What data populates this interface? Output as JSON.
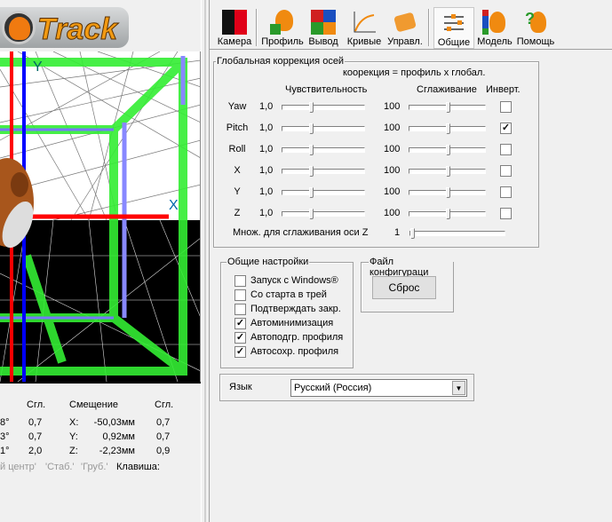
{
  "logo": {
    "text": "Track"
  },
  "toolbar": {
    "items": [
      {
        "label": "Камера",
        "icon": "camera-icon"
      },
      {
        "label": "Профиль",
        "icon": "profile-icon"
      },
      {
        "label": "Вывод",
        "icon": "output-icon"
      },
      {
        "label": "Кривые",
        "icon": "curves-icon"
      },
      {
        "label": "Управл.",
        "icon": "control-icon"
      },
      {
        "label": "Общие",
        "icon": "general-settings-icon",
        "active": true
      },
      {
        "label": "Модель",
        "icon": "model-icon"
      },
      {
        "label": "Помощь",
        "icon": "help-icon"
      }
    ]
  },
  "viewport": {
    "axis_y": "Y",
    "axis_x": "X"
  },
  "bottom": {
    "headers": {
      "smooth1": "Сгл.",
      "offset": "Смещение",
      "smooth2": "Сгл."
    },
    "rows": [
      {
        "rot": "8°",
        "s1": "0,7",
        "axis": "X:",
        "off": "-50,03мм",
        "s2": "0,7"
      },
      {
        "rot": "3°",
        "s1": "0,7",
        "axis": "Y:",
        "off": "0,92мм",
        "s2": "0,7"
      },
      {
        "rot": "1°",
        "s1": "2,0",
        "axis": "Z:",
        "off": "-2,23мм",
        "s2": "0,9"
      }
    ],
    "buttons": [
      "й центр'",
      "'Стаб.'",
      "'Груб.'"
    ],
    "key_label": "Клавиша:"
  },
  "global": {
    "title": "Глобальная коррекция осей",
    "formula": "коорекция = профиль x глобал.",
    "col_sens": "Чувствительность",
    "col_smooth": "Сглаживание",
    "col_invert": "Инверт.",
    "rows": [
      {
        "axis": "Yaw",
        "sens": "1,0",
        "sens_pos": 0.34,
        "smooth": "100",
        "smooth_pos": 0.5,
        "invert": false
      },
      {
        "axis": "Pitch",
        "sens": "1,0",
        "sens_pos": 0.34,
        "smooth": "100",
        "smooth_pos": 0.5,
        "invert": true
      },
      {
        "axis": "Roll",
        "sens": "1,0",
        "sens_pos": 0.34,
        "smooth": "100",
        "smooth_pos": 0.5,
        "invert": false
      },
      {
        "axis": "X",
        "sens": "1,0",
        "sens_pos": 0.34,
        "smooth": "100",
        "smooth_pos": 0.5,
        "invert": false
      },
      {
        "axis": "Y",
        "sens": "1,0",
        "sens_pos": 0.34,
        "smooth": "100",
        "smooth_pos": 0.5,
        "invert": false
      },
      {
        "axis": "Z",
        "sens": "1,0",
        "sens_pos": 0.34,
        "smooth": "100",
        "smooth_pos": 0.5,
        "invert": false
      }
    ],
    "zmult_label": "Множ. для сглаживания оси Z",
    "zmult_value": "1",
    "zmult_pos": 0
  },
  "general": {
    "title": "Общие настройки",
    "options": [
      {
        "label": "Запуск с Windows®",
        "checked": false
      },
      {
        "label": "Со старта в трей",
        "checked": false
      },
      {
        "label": "Подтверждать закр.",
        "checked": false
      },
      {
        "label": "Автоминимизация",
        "checked": true
      },
      {
        "label": "Автоподгр. профиля",
        "checked": true
      },
      {
        "label": "Автосохр. профиля",
        "checked": true
      }
    ]
  },
  "config": {
    "title": "Файл конфигураци",
    "reset": "Сброс"
  },
  "language": {
    "label": "Язык",
    "value": "Русский (Россия)"
  }
}
